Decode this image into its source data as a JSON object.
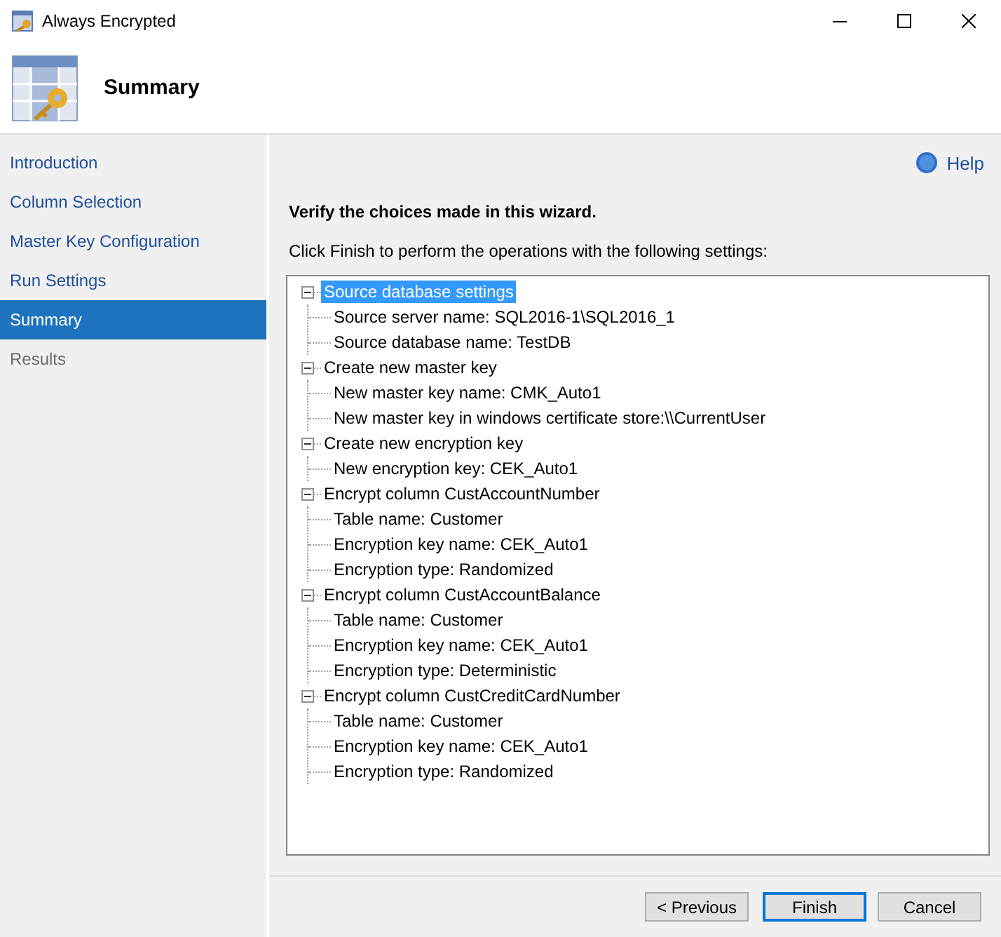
{
  "window": {
    "title": "Always Encrypted"
  },
  "header": {
    "title": "Summary"
  },
  "sidebar": {
    "items": [
      {
        "label": "Introduction",
        "selected": false,
        "disabled": false
      },
      {
        "label": "Column Selection",
        "selected": false,
        "disabled": false
      },
      {
        "label": "Master Key Configuration",
        "selected": false,
        "disabled": false
      },
      {
        "label": "Run Settings",
        "selected": false,
        "disabled": false
      },
      {
        "label": "Summary",
        "selected": true,
        "disabled": false
      },
      {
        "label": "Results",
        "selected": false,
        "disabled": true
      }
    ]
  },
  "help": "Help",
  "heading": "Verify the choices made in this wizard.",
  "instruction": "Click Finish to perform the operations with the following settings:",
  "tree": [
    {
      "label": "Source database settings",
      "expanded": true,
      "selected": true,
      "children": [
        {
          "label": "Source server name: SQL2016-1\\SQL2016_1"
        },
        {
          "label": "Source database name: TestDB"
        }
      ]
    },
    {
      "label": "Create new master key",
      "expanded": true,
      "selected": false,
      "children": [
        {
          "label": "New master key name: CMK_Auto1"
        },
        {
          "label": "New master key in windows certificate store:\\\\CurrentUser"
        }
      ]
    },
    {
      "label": "Create new encryption key",
      "expanded": true,
      "selected": false,
      "children": [
        {
          "label": "New encryption key: CEK_Auto1"
        }
      ]
    },
    {
      "label": "Encrypt column CustAccountNumber",
      "expanded": true,
      "selected": false,
      "children": [
        {
          "label": "Table name: Customer"
        },
        {
          "label": "Encryption key name: CEK_Auto1"
        },
        {
          "label": "Encryption type: Randomized"
        }
      ]
    },
    {
      "label": "Encrypt column CustAccountBalance",
      "expanded": true,
      "selected": false,
      "children": [
        {
          "label": "Table name: Customer"
        },
        {
          "label": "Encryption key name: CEK_Auto1"
        },
        {
          "label": "Encryption type: Deterministic"
        }
      ]
    },
    {
      "label": "Encrypt column CustCreditCardNumber",
      "expanded": true,
      "selected": false,
      "children": [
        {
          "label": "Table name: Customer"
        },
        {
          "label": "Encryption key name: CEK_Auto1"
        },
        {
          "label": "Encryption type: Randomized"
        }
      ]
    }
  ],
  "buttons": [
    {
      "label": "< Previous",
      "default": false
    },
    {
      "label": "Finish",
      "default": true
    },
    {
      "label": "Cancel",
      "default": false
    }
  ]
}
